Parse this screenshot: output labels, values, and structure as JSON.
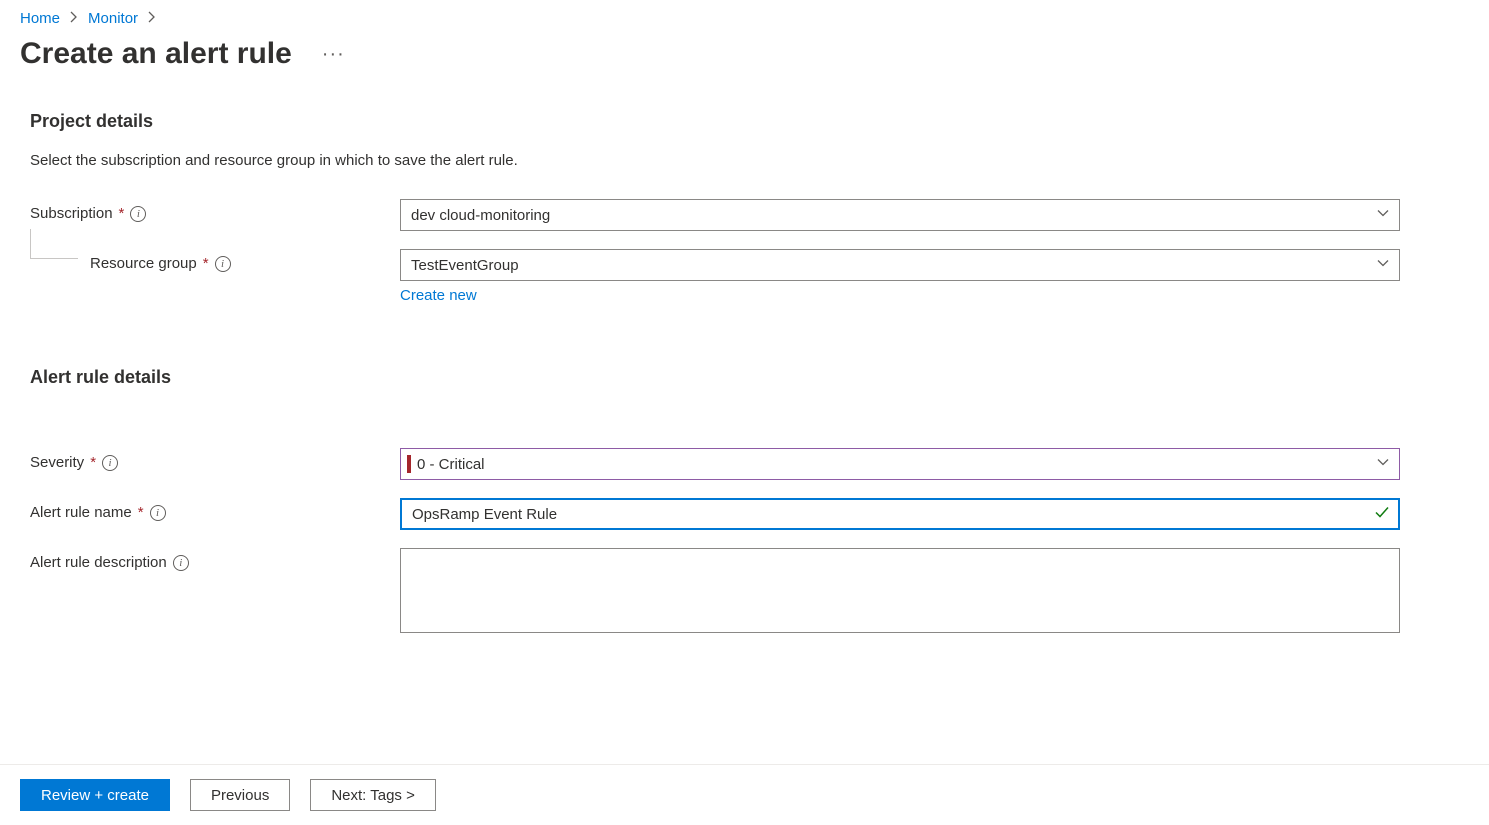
{
  "breadcrumb": {
    "home": "Home",
    "monitor": "Monitor"
  },
  "header": {
    "title": "Create an alert rule"
  },
  "sections": {
    "project": {
      "title": "Project details",
      "description": "Select the subscription and resource group in which to save the alert rule.",
      "subscription_label": "Subscription",
      "subscription_value": "dev cloud-monitoring",
      "resource_group_label": "Resource group",
      "resource_group_value": "TestEventGroup",
      "create_new_label": "Create new"
    },
    "details": {
      "title": "Alert rule details",
      "severity_label": "Severity",
      "severity_value": "0 - Critical",
      "name_label": "Alert rule name",
      "name_value": "OpsRamp Event Rule",
      "description_label": "Alert rule description",
      "description_value": ""
    }
  },
  "footer": {
    "review_create": "Review + create",
    "previous": "Previous",
    "next": "Next: Tags >"
  }
}
